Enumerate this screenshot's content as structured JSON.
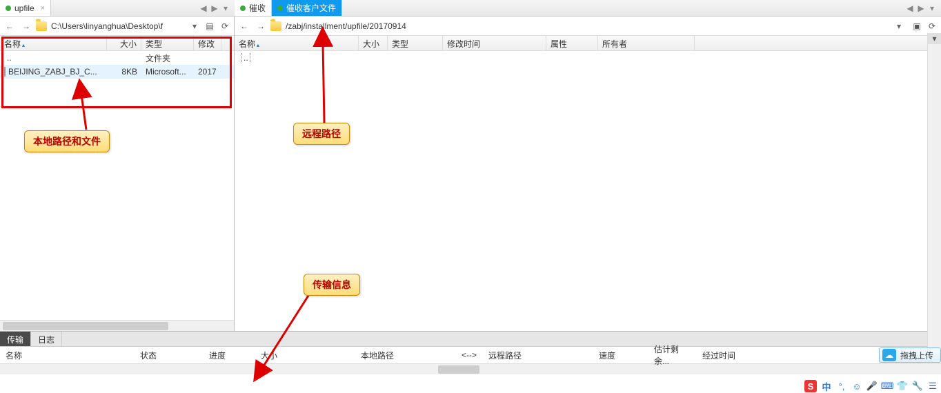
{
  "left_tabs": [
    {
      "label": "upfile",
      "dot_color": "#3aaa3a",
      "active": true
    }
  ],
  "right_tabs": [
    {
      "label": "催收",
      "dot_color": "#3aaa3a",
      "active": true,
      "blue": false
    },
    {
      "label": "催收客户文件",
      "dot_color": "#3aaa3a",
      "active": false,
      "blue": true
    }
  ],
  "left_path": "C:\\Users\\linyanghua\\Desktop\\f",
  "right_path": "/zabj/installment/upfile/20170914",
  "left_columns": {
    "name": "名称",
    "size": "大小",
    "type": "类型",
    "mtime": "修改"
  },
  "right_columns": {
    "name": "名称",
    "size": "大小",
    "type": "类型",
    "mtime": "修改时间",
    "attr": "属性",
    "owner": "所有者"
  },
  "left_rows": [
    {
      "name": "..",
      "size": "",
      "type": "文件夹",
      "mtime": "",
      "icon": "folder"
    },
    {
      "name": "BEIJING_ZABJ_BJ_C...",
      "size": "8KB",
      "type": "Microsoft...",
      "mtime": "2017",
      "icon": "doc"
    }
  ],
  "right_rows": [
    {
      "name": "..",
      "size": "",
      "type": "",
      "mtime": "",
      "attr": "",
      "owner": "",
      "icon": "folder"
    }
  ],
  "callouts": {
    "local": "本地路径和文件",
    "remote": "远程路径",
    "transfer": "传输信息"
  },
  "bottom_tabs": {
    "transfer": "传输",
    "log": "日志"
  },
  "transfer_columns": {
    "name": "名称",
    "status": "状态",
    "progress": "进度",
    "size": "大小",
    "lpath": "本地路径",
    "arrow": "<-->",
    "rpath": "远程路径",
    "speed": "速度",
    "eta": "估计剩余...",
    "elapsed": "经过时间"
  },
  "upload_button": "拖拽上传",
  "tray_ime": "中"
}
